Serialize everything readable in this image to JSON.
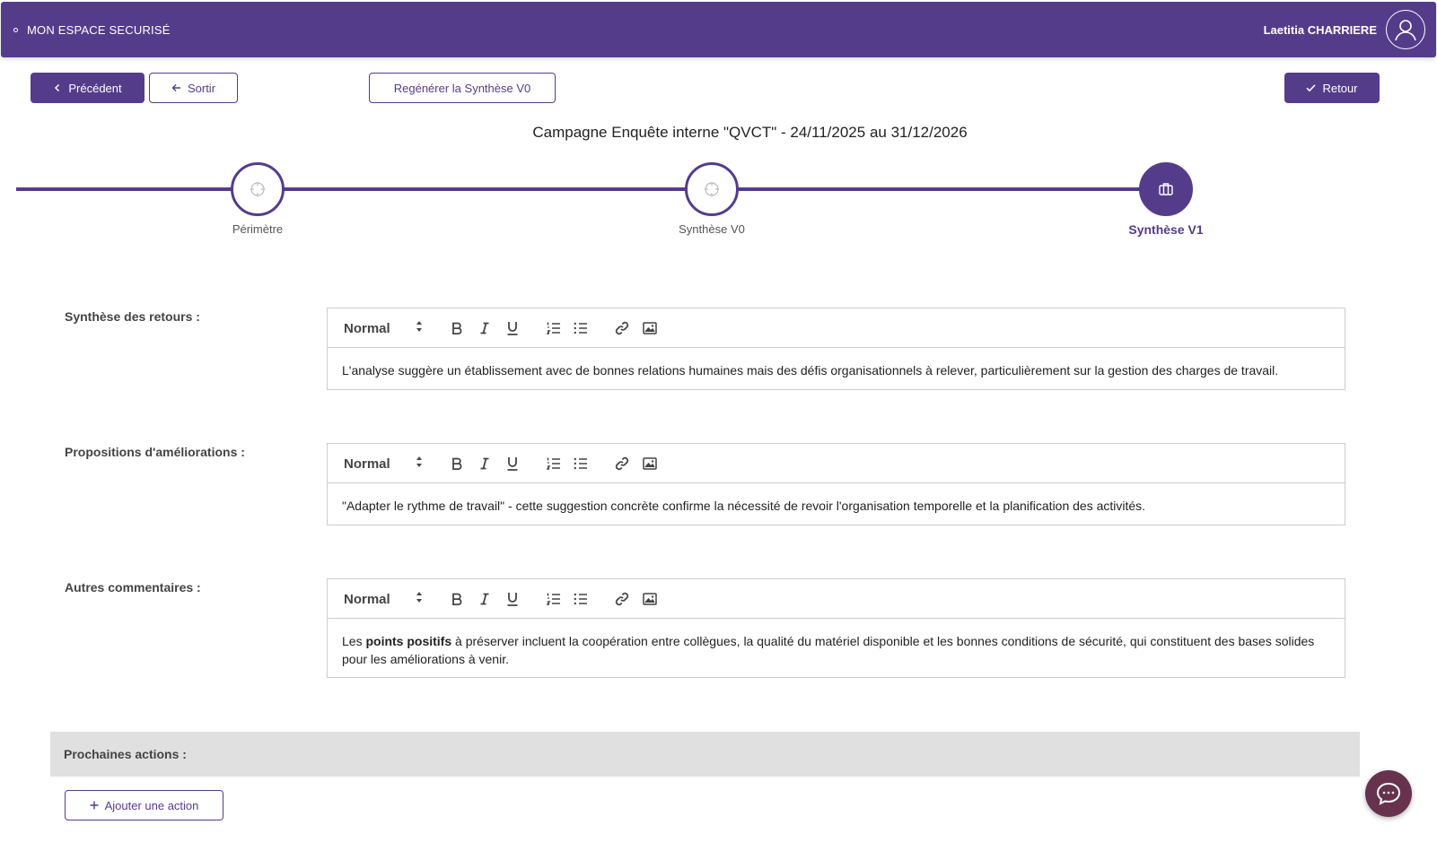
{
  "header": {
    "brand": "MON ESPACE SECURISÉ",
    "user_name": "Laetitia CHARRIERE"
  },
  "actions": {
    "previous_label": "Précédent",
    "exit_label": "Sortir",
    "regenerate_label": "Regénérer la Synthèse V0",
    "back_label": "Retour"
  },
  "campaign": {
    "title": "Campagne Enquête interne \"QVCT\" - 24/11/2025 au 31/12/2026"
  },
  "stepper": {
    "steps": [
      {
        "label": "Périmètre",
        "icon": "crosshair-icon",
        "state": "done"
      },
      {
        "label": "Synthèse V0",
        "icon": "crosshair-icon",
        "state": "done"
      },
      {
        "label": "Synthèse V1",
        "icon": "briefcase-icon",
        "state": "active"
      }
    ]
  },
  "editor": {
    "format_value": "Normal"
  },
  "sections": {
    "feedback": {
      "label": "Synthèse des retours :",
      "content": "L'analyse suggère un établissement avec de bonnes relations humaines mais des défis organisationnels à relever, particulièrement sur la gestion des charges de travail."
    },
    "improvements": {
      "label": "Propositions d'améliorations :",
      "content": "\"Adapter le rythme de travail\" - cette suggestion concrète confirme la nécessité de revoir l'organisation temporelle et la planification des activités."
    },
    "comments": {
      "label": "Autres commentaires :",
      "content_prefix": "Les",
      "content_bold": "points positifs",
      "content_suffix": "à préserver incluent la coopération entre collègues, la qualité du matériel disponible et les bonnes conditions de sécurité, qui constituent des bases solides pour les améliorations à venir."
    }
  },
  "next_actions": {
    "label": "Prochaines actions :",
    "add_label": "Ajouter une action"
  },
  "colors": {
    "primary": "#553c8b",
    "panel_gray": "#e0e0e0",
    "chat": "#66324d"
  }
}
